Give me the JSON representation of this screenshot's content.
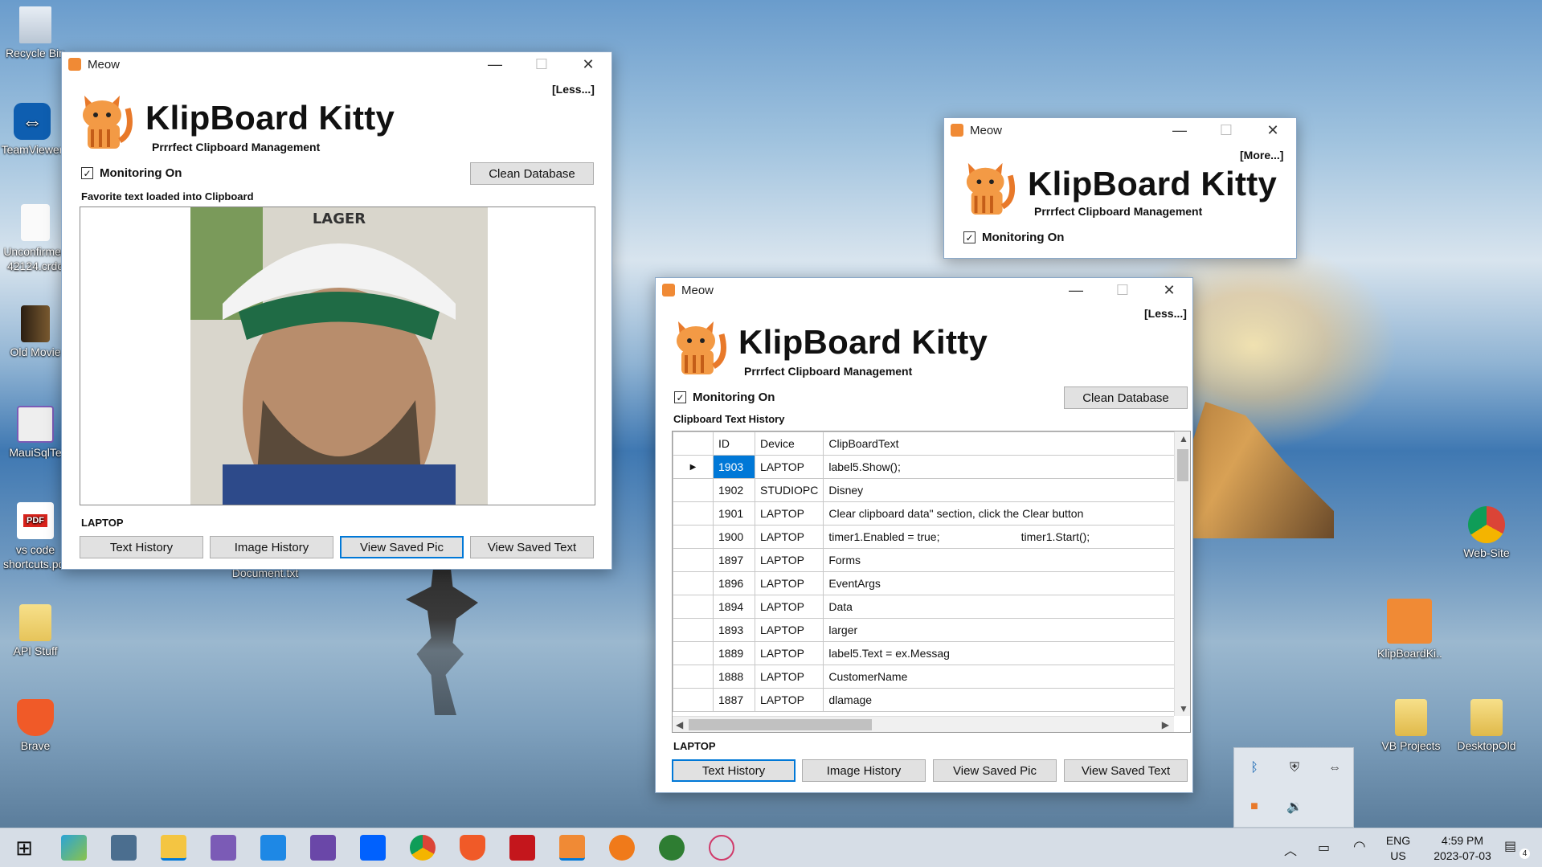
{
  "desktop": {
    "left_icons": [
      {
        "label": "Recycle Bin",
        "icon": "recycle-bin-icon"
      },
      {
        "label": "TeamViewer",
        "icon": "teamviewer-icon"
      },
      {
        "label": "Unconfirmed 42124.crdo",
        "icon": "file-icon"
      },
      {
        "label": "Old Movie",
        "icon": "file-icon"
      },
      {
        "label": "MauiSqlTe",
        "icon": "visual-studio-icon"
      },
      {
        "label": "vs code shortcuts.pdf",
        "icon": "pdf-icon"
      },
      {
        "label": "API Stuff",
        "icon": "folder-icon"
      },
      {
        "label": "Brave",
        "icon": "brave-icon"
      }
    ],
    "right_icons": [
      {
        "label": "Web-Site",
        "icon": "chrome-shortcut-icon"
      },
      {
        "label": "KlipBoardKi...",
        "icon": "klipboardkitty-icon"
      },
      {
        "label": "VB Projects",
        "icon": "folder-icon"
      },
      {
        "label": "DesktopOld",
        "icon": "folder-icon"
      }
    ],
    "under_window_label": "Document.txt"
  },
  "window_left": {
    "title": "Meow",
    "toggle": "[Less...]",
    "brand": "KlipBoard Kitty",
    "tagline": "Prrrfect Clipboard Management",
    "monitoring_label": "Monitoring On",
    "clean_button": "Clean Database",
    "status_text": "Favorite text loaded into Clipboard",
    "device_label": "LAPTOP",
    "buttons": [
      "Text History",
      "Image History",
      "View Saved Pic",
      "View Saved Text"
    ]
  },
  "window_small": {
    "title": "Meow",
    "toggle": "[More...]",
    "brand": "KlipBoard Kitty",
    "tagline": "Prrrfect Clipboard Management",
    "monitoring_label": "Monitoring On"
  },
  "window_main": {
    "title": "Meow",
    "toggle": "[Less...]",
    "brand": "KlipBoard Kitty",
    "tagline": "Prrrfect Clipboard Management",
    "monitoring_label": "Monitoring On",
    "clean_button": "Clean Database",
    "section_label": "Clipboard Text History",
    "device_label": "LAPTOP",
    "buttons": [
      "Text History",
      "Image History",
      "View Saved Pic",
      "View Saved Text"
    ],
    "grid": {
      "columns": [
        "ID",
        "Device",
        "ClipBoardText"
      ],
      "rows": [
        [
          "1903",
          "LAPTOP",
          " label5.Show();"
        ],
        [
          "1902",
          "STUDIOPC",
          "Disney"
        ],
        [
          "1901",
          "LAPTOP",
          "Clear clipboard data\" section, click the Clear button"
        ],
        [
          "1900",
          "LAPTOP",
          "timer1.Enabled = true;                          timer1.Start();"
        ],
        [
          "1897",
          "LAPTOP",
          "Forms"
        ],
        [
          "1896",
          "LAPTOP",
          "EventArgs"
        ],
        [
          "1894",
          "LAPTOP",
          "Data"
        ],
        [
          "1893",
          "LAPTOP",
          "larger"
        ],
        [
          "1889",
          "LAPTOP",
          "label5.Text = ex.Messag"
        ],
        [
          "1888",
          "LAPTOP",
          "CustomerName"
        ],
        [
          "1887",
          "LAPTOP",
          "dlamage"
        ]
      ]
    }
  },
  "taskbar": {
    "apps": [
      "start-icon",
      "snipping-icon",
      "app-icon",
      "file-explorer-icon",
      "visual-studio-icon",
      "vscode-icon",
      "visual-studio-icon",
      "dropbox-icon",
      "chrome-icon",
      "brave-icon",
      "filezilla-icon",
      "klipboardkitty-icon",
      "pen-icon",
      "app-icon",
      "paint-icon"
    ],
    "language": "ENG",
    "region": "US",
    "time": "4:59 PM",
    "date": "2023-07-03",
    "notifications": "4"
  },
  "colors": {
    "accent": "#0078d7",
    "selected_row": "#0078d7"
  }
}
